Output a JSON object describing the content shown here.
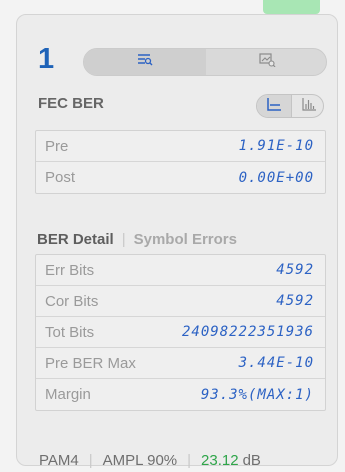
{
  "lane": {
    "number": "1"
  },
  "view_toggle": {
    "active": "table-view",
    "options": [
      "table-view-icon",
      "chart-view-icon"
    ]
  },
  "fec_ber": {
    "title": "FEC BER",
    "chart_toggle": [
      "line-chart-icon",
      "histogram-icon"
    ],
    "rows": [
      {
        "label": "Pre",
        "value": "1.91E-10"
      },
      {
        "label": "Post",
        "value": "0.00E+00"
      }
    ]
  },
  "detail_tabs": {
    "active": "BER Detail",
    "inactive": "Symbol Errors",
    "separator": "|"
  },
  "ber_detail": {
    "rows": [
      {
        "label": "Err Bits",
        "value": "4592"
      },
      {
        "label": "Cor Bits",
        "value": "4592"
      },
      {
        "label": "Tot Bits",
        "value": "24098222351936"
      },
      {
        "label": "Pre BER Max",
        "value": "3.44E-10"
      },
      {
        "label": "Margin",
        "value": "93.3%(MAX:1)"
      }
    ]
  },
  "footer": {
    "modulation": "PAM4",
    "amplitude": "AMPL 90%",
    "snr_value": "23.12",
    "snr_unit": "dB",
    "separator": "|"
  },
  "colors": {
    "accent": "#1f63b8",
    "value": "#2c62c4",
    "ok": "#2fa54a",
    "top_tab": "#a8e6b4"
  }
}
